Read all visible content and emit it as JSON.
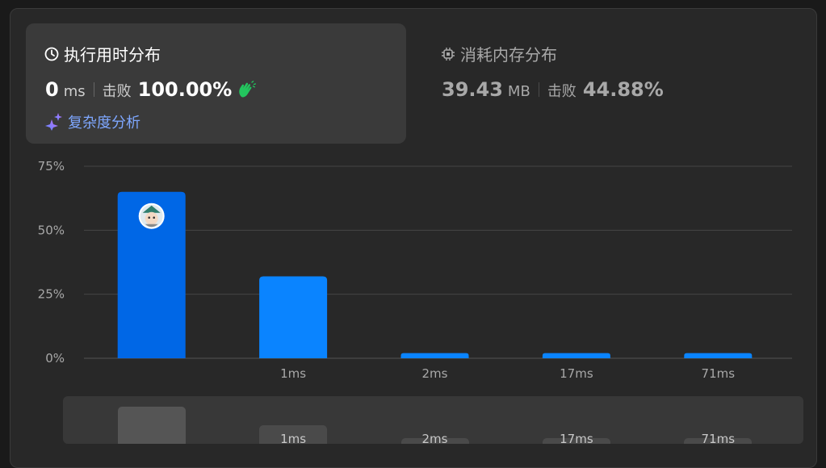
{
  "runtime": {
    "title": "执行用时分布",
    "value": "0",
    "unit": "ms",
    "beat_label": "击败",
    "beat_value": "100.00%",
    "analysis_label": "复杂度分析",
    "icon": "clock-icon",
    "badge_icon": "clapping-hands-icon",
    "accent_color": "#7ea7ff"
  },
  "memory": {
    "title": "消耗内存分布",
    "value": "39.43",
    "unit": "MB",
    "beat_label": "击败",
    "beat_value": "44.88%",
    "icon": "chip-icon"
  },
  "chart_data": {
    "type": "bar",
    "categories": [
      "",
      "1ms",
      "2ms",
      "17ms",
      "71ms"
    ],
    "values": [
      65,
      32,
      2,
      2,
      2
    ],
    "ylim": [
      0,
      75
    ],
    "yticks": [
      "0%",
      "25%",
      "50%",
      "75%"
    ],
    "ytick_values": [
      0,
      25,
      50,
      75
    ],
    "grid": true,
    "bar_colors": [
      "#0067e6",
      "#0a84ff",
      "#0a84ff",
      "#0a84ff",
      "#0a84ff"
    ],
    "highlighted_index": 0,
    "marker": "user-avatar-icon"
  },
  "navigator": {
    "labels": [
      "",
      "1ms",
      "2ms",
      "17ms",
      "71ms"
    ]
  }
}
